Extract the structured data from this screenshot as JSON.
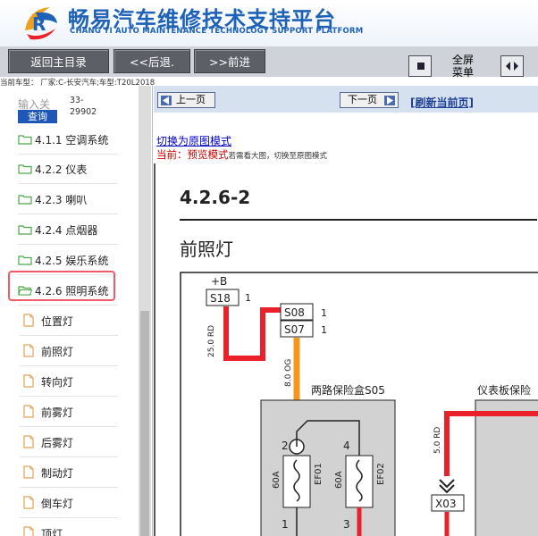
{
  "header": {
    "title_cn": "畅易汽车维修技术支持平台",
    "title_en": "CHANG YI AUTO MAINTENANCE TECHNOLOGY SUPPORT PLATFORM"
  },
  "toolbar": {
    "home_label": "返回主目录",
    "back_label": "<<后退.",
    "forward_label": ">>前进",
    "fullscreen_label_1": "全屏",
    "fullscreen_label_2": "菜单"
  },
  "model_line": "当前车型： 厂家:C-长安汽车;车型:T20L2018",
  "sidebar": {
    "search_placeholder": "输入关",
    "search_code": "33-\n29902",
    "query_label": "查询",
    "items": [
      {
        "label": "4.1.1 空调系统",
        "type": "folder"
      },
      {
        "label": "4.2.2 仪表",
        "type": "folder"
      },
      {
        "label": "4.2.3 喇叭",
        "type": "folder"
      },
      {
        "label": "4.2.4 点烟器",
        "type": "folder"
      },
      {
        "label": "4.2.5 娱乐系统",
        "type": "folder"
      },
      {
        "label": "4.2.6 照明系统",
        "type": "folder-open"
      },
      {
        "label": "位置灯",
        "type": "file"
      },
      {
        "label": "前照灯",
        "type": "file"
      },
      {
        "label": "转向灯",
        "type": "file"
      },
      {
        "label": "前雾灯",
        "type": "file"
      },
      {
        "label": "后雾灯",
        "type": "file"
      },
      {
        "label": "制动灯",
        "type": "file"
      },
      {
        "label": "倒车灯",
        "type": "file"
      },
      {
        "label": "顶灯",
        "type": "file"
      }
    ]
  },
  "nav": {
    "prev_label": "上一页",
    "next_label": "下一页",
    "refresh_label": "[刷新当前页]"
  },
  "mode": {
    "switch_link": "切换为原图模式",
    "current_prefix": "当前：",
    "current_mode": "预览模式",
    "hint": "若需看大图，切换至原图模式"
  },
  "document": {
    "section_number": "4.2.6-2",
    "section_title": "前照灯"
  },
  "diagram": {
    "supply": "+B",
    "connectors": [
      "S18",
      "S08",
      "S07"
    ],
    "pins": [
      "1",
      "1",
      "1",
      "2",
      "4",
      "1",
      "3"
    ],
    "wires": [
      "25.0 RD",
      "8.0 OG",
      "5.0 RD"
    ],
    "box_1": "两路保险盒S05",
    "box_2": "仪表板保险",
    "fuses": [
      "EF01",
      "EF02"
    ],
    "fuse_ratings": [
      "60A",
      "60A"
    ],
    "connector_x03": "X03"
  },
  "colors": {
    "brand_blue": "#1e62b8",
    "wire_red": "#e8212b",
    "wire_orange": "#f5961f",
    "highlight": "#f05b6a"
  }
}
